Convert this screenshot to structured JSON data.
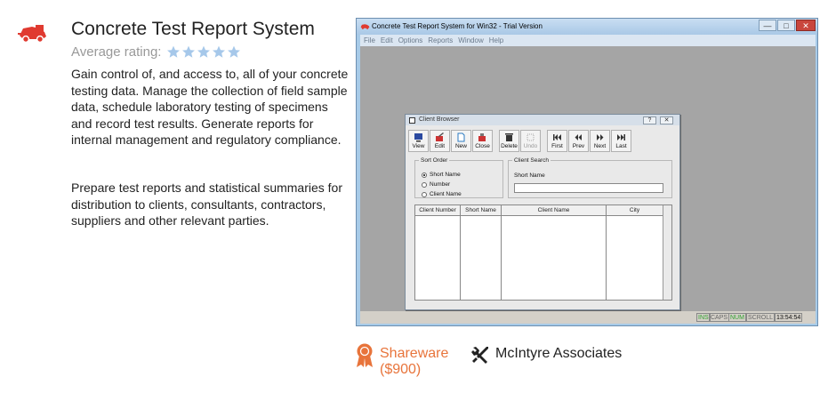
{
  "product": {
    "title": "Concrete Test Report System",
    "rating_label": "Average rating:",
    "rating_stars": 5,
    "description": [
      "Gain control of, and access to, all of your concrete testing data. Manage the collection of field sample data, schedule laboratory testing of specimens and record test results. Generate reports for internal management and regulatory compliance.",
      "Prepare test reports and statistical summaries for distribution to clients, consultants, contractors, suppliers and other relevant parties."
    ],
    "license": "Shareware",
    "price": "($900)",
    "developer": "McIntyre Associates",
    "colors": {
      "accent": "#e8743b",
      "star": "#a6c8ea",
      "logo": "#e03a30"
    }
  },
  "screenshot": {
    "window_title": "Concrete Test Report System for Win32 - Trial Version",
    "window_controls": [
      "—",
      "□",
      "✕"
    ],
    "menu": [
      "File",
      "Edit",
      "Options",
      "Reports",
      "Window",
      "Help"
    ],
    "dialog": {
      "title": "Client Browser",
      "help": "?",
      "close": "✕",
      "toolbar": [
        {
          "label": "View",
          "icon": "view-icon",
          "disabled": false
        },
        {
          "label": "Edit",
          "icon": "edit-icon",
          "disabled": false
        },
        {
          "label": "New",
          "icon": "new-icon",
          "disabled": false
        },
        {
          "label": "Close",
          "icon": "close-record-icon",
          "disabled": false
        },
        {
          "label": "Delete",
          "icon": "delete-icon",
          "disabled": false
        },
        {
          "label": "Undo",
          "icon": "undo-icon",
          "disabled": true
        },
        {
          "label": "First",
          "icon": "first-icon",
          "disabled": false
        },
        {
          "label": "Prev",
          "icon": "prev-icon",
          "disabled": false
        },
        {
          "label": "Next",
          "icon": "next-icon",
          "disabled": false
        },
        {
          "label": "Last",
          "icon": "last-icon",
          "disabled": false
        }
      ],
      "sort_order": {
        "label": "Sort Order",
        "options": [
          "Short Name",
          "Number",
          "Client Name"
        ],
        "selected": "Short Name"
      },
      "client_search": {
        "label": "Client Search",
        "field_label": "Short Name",
        "value": ""
      },
      "columns": [
        "Client Number",
        "Short Name",
        "Client Name",
        "City"
      ]
    },
    "status": [
      "INS",
      "CAPS",
      "NUM",
      "SCROLL",
      "13:54:54"
    ],
    "status_active": [
      "INS",
      "NUM"
    ]
  }
}
